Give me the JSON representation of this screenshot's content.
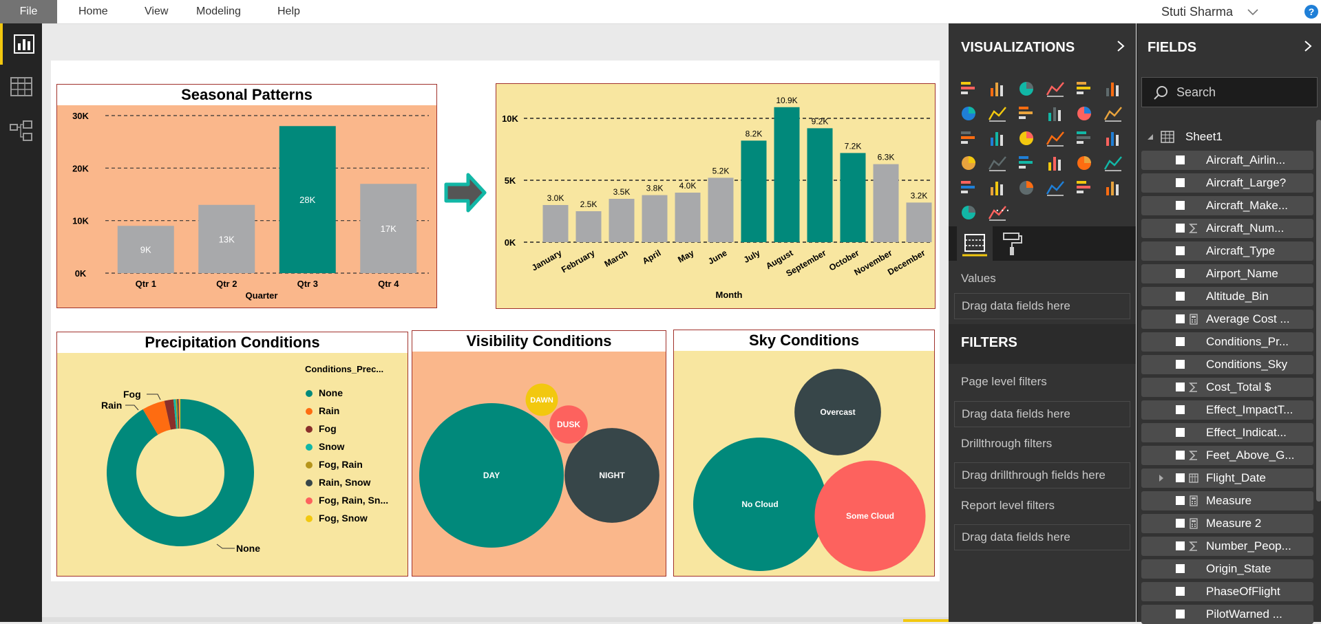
{
  "menu": {
    "file": "File",
    "items": [
      "Home",
      "View",
      "Modeling",
      "Help"
    ],
    "user": "Stuti Sharma",
    "help": "?"
  },
  "colors": {
    "teal": "#01897b",
    "grey": "#a8a9ab",
    "salmon": "#fab78b",
    "cream": "#f8e6a0",
    "red": "#fd625e",
    "dark": "#374649",
    "yellow": "#f2c80f",
    "accent": "#f2c80f"
  },
  "seasonal": {
    "title": "Seasonal Patterns",
    "chart_data": {
      "type": "bar",
      "categories": [
        "Qtr 1",
        "Qtr 2",
        "Qtr 3",
        "Qtr 4"
      ],
      "values": [
        9000,
        13000,
        28000,
        17000
      ],
      "data_labels": [
        "9K",
        "13K",
        "28K",
        "17K"
      ],
      "highlight": [
        false,
        false,
        true,
        false
      ],
      "xlabel": "Quarter",
      "ylabel": "",
      "yticks": [
        "0K",
        "10K",
        "20K",
        "30K"
      ],
      "ylim": [
        0,
        30000
      ],
      "grid": true
    }
  },
  "monthly": {
    "title": "",
    "chart_data": {
      "type": "bar",
      "categories": [
        "January",
        "February",
        "March",
        "April",
        "May",
        "June",
        "July",
        "August",
        "September",
        "October",
        "November",
        "December"
      ],
      "values": [
        3000,
        2500,
        3500,
        3800,
        4000,
        5200,
        8200,
        10900,
        9200,
        7200,
        6300,
        3200
      ],
      "data_labels": [
        "3.0K",
        "2.5K",
        "3.5K",
        "3.8K",
        "4.0K",
        "5.2K",
        "8.2K",
        "10.9K",
        "9.2K",
        "7.2K",
        "6.3K",
        "3.2K"
      ],
      "highlight": [
        false,
        false,
        false,
        false,
        false,
        false,
        true,
        true,
        true,
        true,
        false,
        false
      ],
      "xlabel": "Month",
      "yticks": [
        "0K",
        "5K",
        "10K"
      ],
      "ylim": [
        0,
        10000
      ],
      "grid": true
    }
  },
  "precip": {
    "title": "Precipitation Conditions",
    "legend_title": "Conditions_Prec...",
    "legend": [
      "None",
      "Rain",
      "Fog",
      "Snow",
      "Fog, Rain",
      "Rain, Snow",
      "Fog, Rain, Sn...",
      "Fog, Snow"
    ],
    "legend_colors": [
      "#01897b",
      "#fe6c11",
      "#8a2f2a",
      "#12b7a6",
      "#b6951c",
      "#374649",
      "#fd625e",
      "#f2c80f"
    ],
    "chart_data": {
      "type": "pie",
      "categories": [
        "None",
        "Rain",
        "Fog",
        "Snow",
        "Fog, Rain",
        "Rain, Snow",
        "Fog, Rain, Sn...",
        "Fog, Snow"
      ],
      "values": [
        91.5,
        5.0,
        2.0,
        0.5,
        0.3,
        0.3,
        0.2,
        0.2
      ],
      "labeled": [
        "None",
        "Rain",
        "Fog"
      ],
      "donut": true
    }
  },
  "visibility": {
    "title": "Visibility Conditions",
    "chart_data": {
      "type": "bubble",
      "categories": [
        "DAY",
        "NIGHT",
        "DUSK",
        "DAWN"
      ],
      "values": [
        100,
        43,
        7,
        5
      ],
      "colors": [
        "#01897b",
        "#374649",
        "#fd625e",
        "#f2c80f"
      ]
    }
  },
  "sky": {
    "title": "Sky Conditions",
    "chart_data": {
      "type": "bubble",
      "categories": [
        "No Cloud",
        "Some Cloud",
        "Overcast"
      ],
      "values": [
        100,
        69,
        42
      ],
      "colors": [
        "#01897b",
        "#fd625e",
        "#374649"
      ]
    }
  },
  "viz_pane": {
    "title": "VISUALIZATIONS",
    "values_label": "Values",
    "values_drop": "Drag data fields here",
    "filters_title": "FILTERS",
    "page_filters": "Page level filters",
    "page_drop": "Drag data fields here",
    "drill_filters": "Drillthrough filters",
    "drill_drop": "Drag drillthrough fields here",
    "report_filters": "Report level filters",
    "report_drop": "Drag data fields here",
    "more": "..."
  },
  "fields_pane": {
    "title": "FIELDS",
    "search_placeholder": "Search",
    "table": "Sheet1",
    "fields": [
      {
        "label": "Aircraft_Airlin...",
        "type": ""
      },
      {
        "label": "Aircraft_Large?",
        "type": ""
      },
      {
        "label": "Aircraft_Make...",
        "type": ""
      },
      {
        "label": "Aircraft_Num...",
        "type": "sigma"
      },
      {
        "label": "Aircraft_Type",
        "type": ""
      },
      {
        "label": "Airport_Name",
        "type": ""
      },
      {
        "label": "Altitude_Bin",
        "type": ""
      },
      {
        "label": "Average Cost ...",
        "type": "calc"
      },
      {
        "label": "Conditions_Pr...",
        "type": ""
      },
      {
        "label": "Conditions_Sky",
        "type": ""
      },
      {
        "label": "Cost_Total $",
        "type": "sigma"
      },
      {
        "label": "Effect_ImpactT...",
        "type": ""
      },
      {
        "label": "Effect_Indicat...",
        "type": ""
      },
      {
        "label": "Feet_Above_G...",
        "type": "sigma"
      },
      {
        "label": "Flight_Date",
        "type": "date"
      },
      {
        "label": "Measure",
        "type": "calc"
      },
      {
        "label": "Measure 2",
        "type": "calc"
      },
      {
        "label": "Number_Peop...",
        "type": "sigma"
      },
      {
        "label": "Origin_State",
        "type": ""
      },
      {
        "label": "PhaseOfFlight",
        "type": ""
      },
      {
        "label": "PilotWarned ...",
        "type": ""
      }
    ]
  }
}
